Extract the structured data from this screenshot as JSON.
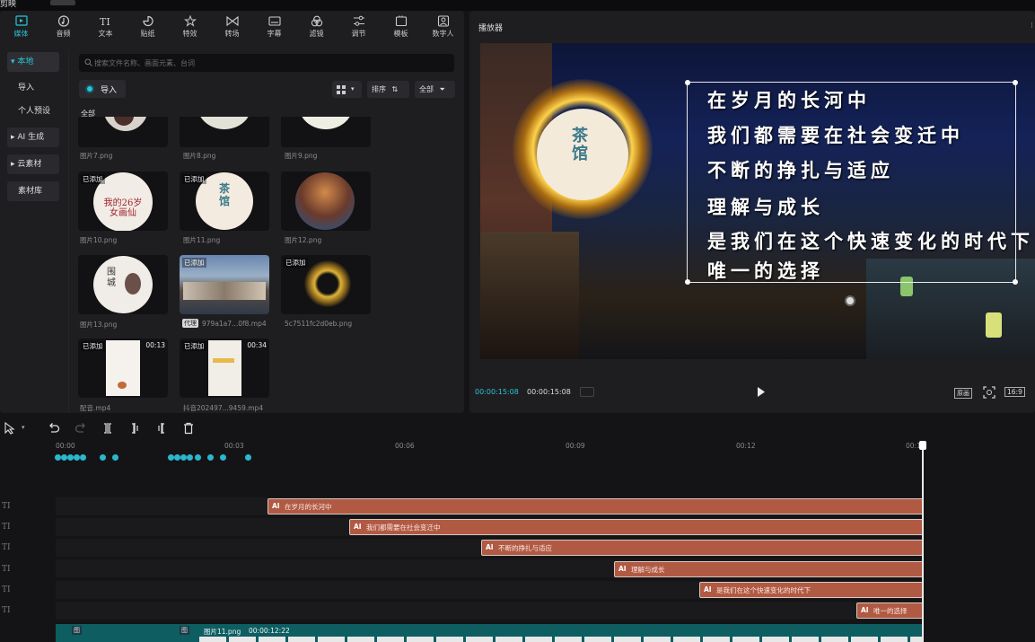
{
  "titlebar": {
    "app_name": "剪映"
  },
  "toolbar": {
    "items": [
      {
        "label": "媒体",
        "icon": "media-icon"
      },
      {
        "label": "音频",
        "icon": "audio-icon"
      },
      {
        "label": "文本",
        "icon": "text-icon"
      },
      {
        "label": "贴纸",
        "icon": "sticker-icon"
      },
      {
        "label": "特效",
        "icon": "effects-icon"
      },
      {
        "label": "转场",
        "icon": "transition-icon"
      },
      {
        "label": "字幕",
        "icon": "subtitle-icon"
      },
      {
        "label": "滤镜",
        "icon": "filter-icon"
      },
      {
        "label": "调节",
        "icon": "adjust-icon"
      },
      {
        "label": "模板",
        "icon": "template-icon"
      },
      {
        "label": "数字人",
        "icon": "digital-human-icon"
      }
    ]
  },
  "sidebar": {
    "local": "本地",
    "import": "导入",
    "presets": "个人预设",
    "ai": "AI 生成",
    "cloud": "云素材",
    "library": "素材库"
  },
  "search": {
    "placeholder": "搜索文件名称、画面元素、台词"
  },
  "media": {
    "import_label": "导入",
    "sort_label": "排序",
    "filter_label": "全部",
    "section_label": "全部",
    "added_label": "已添加",
    "proxy_label": "代理",
    "items": [
      {
        "name": "图片7.png"
      },
      {
        "name": "图片8.png"
      },
      {
        "name": "图片9.png"
      },
      {
        "name": "图片10.png",
        "overlay": "我的26岁女画仙"
      },
      {
        "name": "图片11.png",
        "overlay": "茶馆"
      },
      {
        "name": "图片12.png"
      },
      {
        "name": "图片13.png",
        "overlay": "围城"
      },
      {
        "name": "979a1a7...0f8.mp4"
      },
      {
        "name": "5c7511fc2d0eb.png"
      },
      {
        "name": "配音.mp4",
        "duration": "00:13"
      },
      {
        "name": "抖音202497...9459.mp4",
        "duration": "00:34"
      }
    ]
  },
  "player": {
    "title": "播放器",
    "lyrics": [
      "在岁月的长河中",
      "我们都需要在社会变迁中",
      "不断的挣扎与适应",
      "理解与成长",
      "是我们在这个快速变化的时代下",
      "唯一的选择"
    ],
    "badge_text": "茶馆",
    "current_time": "00:00:15:08",
    "total_time": "00:00:15:08",
    "ratio": "16:9",
    "original_label": "原画"
  },
  "timeline": {
    "ticks": [
      "00:00",
      "00:03",
      "00:06",
      "00:09",
      "00:12",
      "00:1"
    ],
    "track_icon": "TI",
    "text_clips": [
      {
        "text": "在岁月的长河中"
      },
      {
        "text": "我们都需要在社会变迁中"
      },
      {
        "text": "不断的挣扎与适应"
      },
      {
        "text": "理解与成长"
      },
      {
        "text": "是我们在这个快速变化的时代下"
      },
      {
        "text": "唯一的选择"
      }
    ],
    "video_clip": {
      "name": "图片11.png",
      "duration": "00:00:12:22"
    },
    "ai_badge": "AI",
    "img_badge": "图"
  },
  "colors": {
    "accent": "#29c4d6",
    "clip": "#b15a43",
    "video_track": "#0d5d61"
  }
}
